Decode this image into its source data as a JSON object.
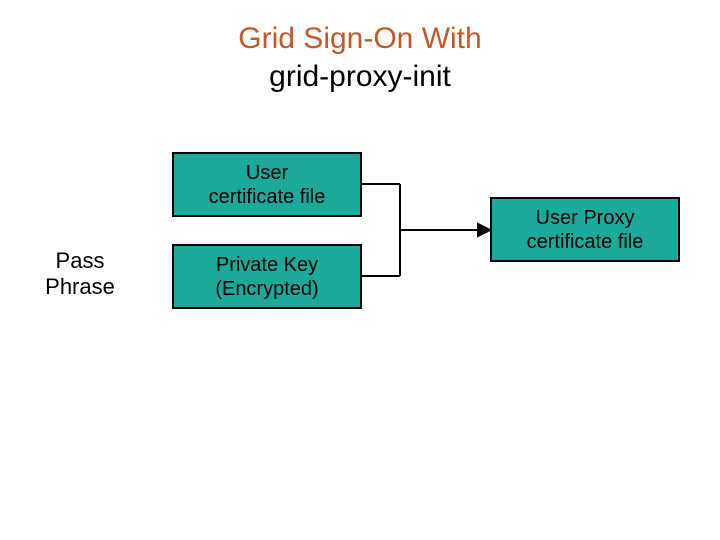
{
  "title": {
    "line1": "Grid Sign-On With",
    "line2": "grid-proxy-init"
  },
  "nodes": {
    "pass_phrase": "Pass\nPhrase",
    "user_cert": "User\ncertificate file",
    "private_key": "Private Key\n(Encrypted)",
    "user_proxy": "User Proxy\ncertificate file"
  },
  "colors": {
    "accent_box": "#1aa99a",
    "title_accent": "#c05a2a"
  }
}
